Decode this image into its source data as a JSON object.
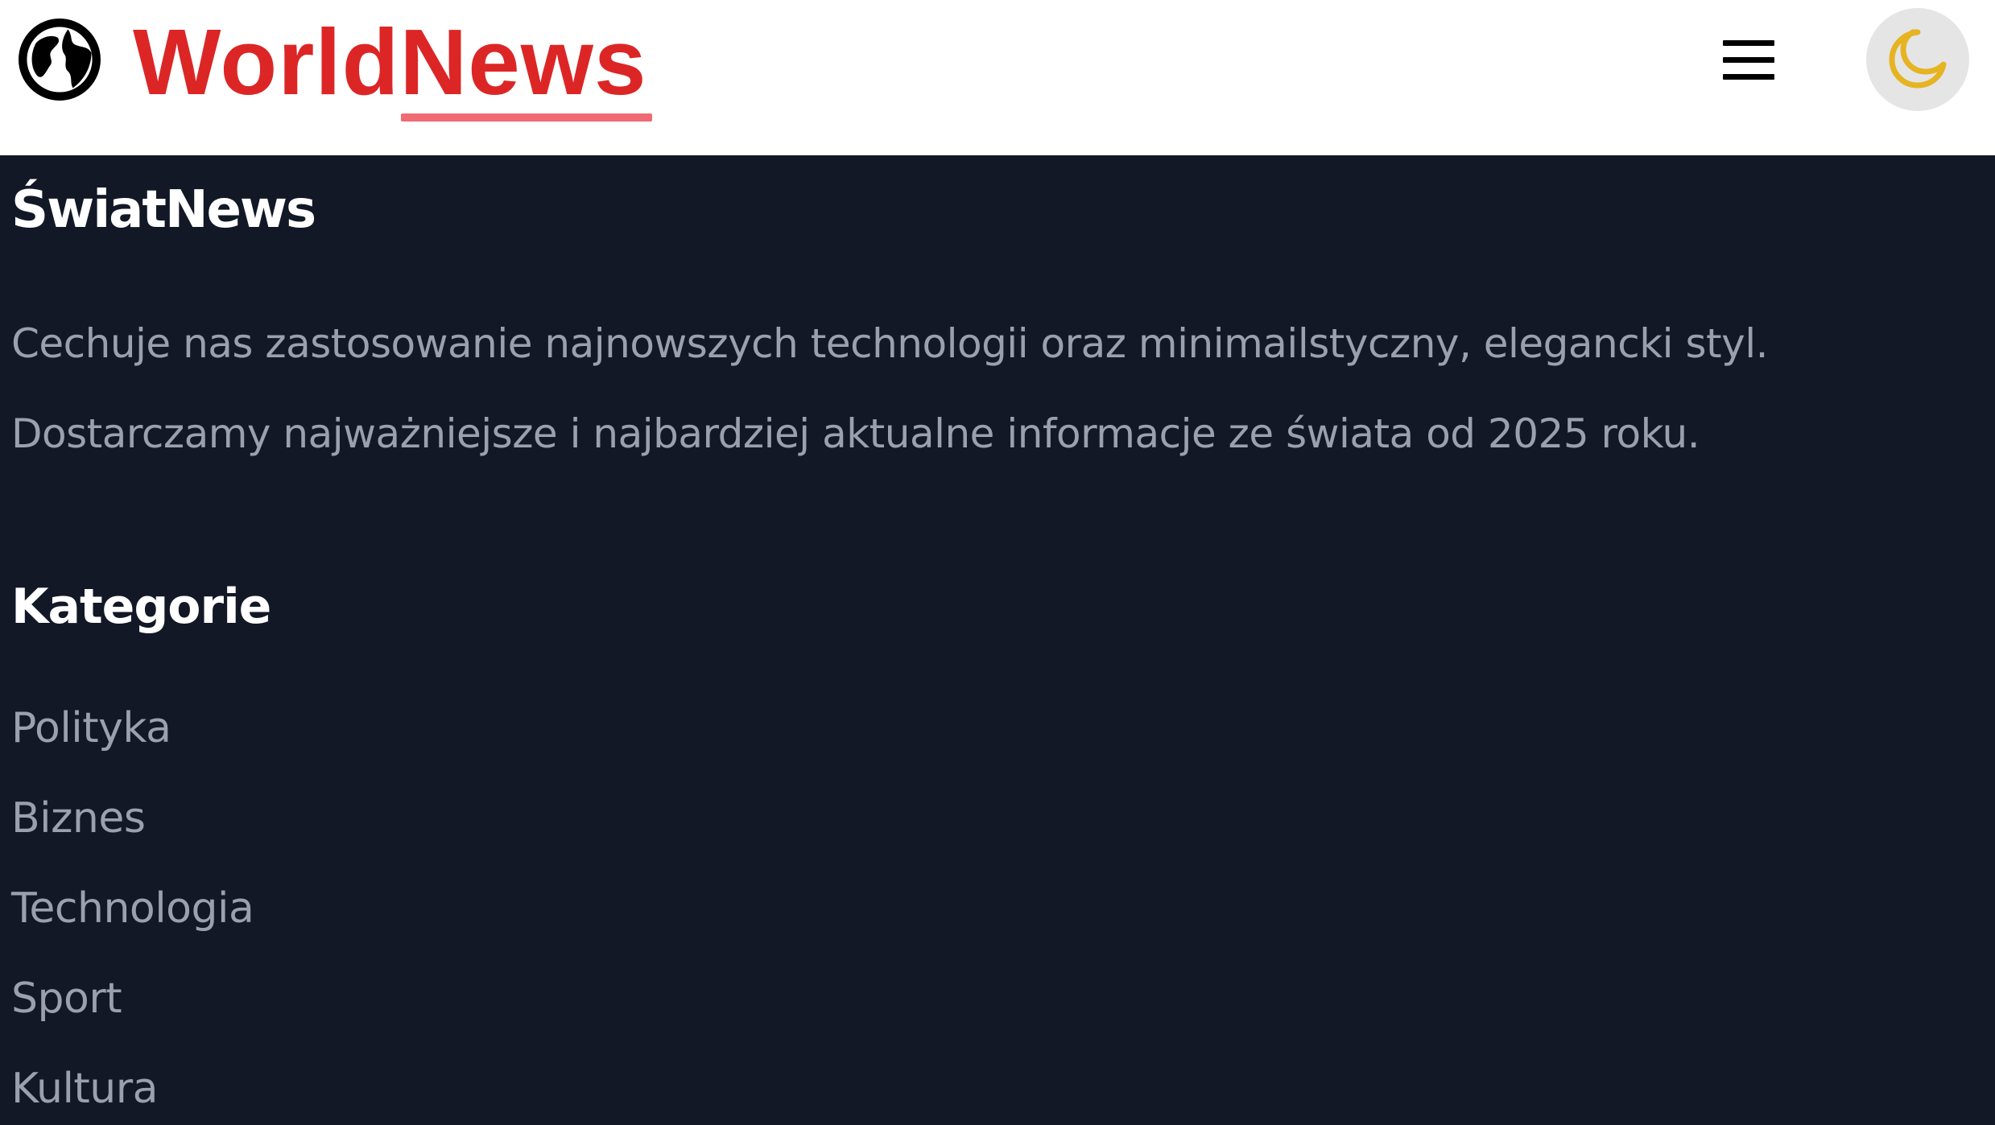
{
  "header": {
    "brand_part1": "World",
    "brand_part2": "News",
    "brand_color": "#dc2626",
    "underline_color": "#f06a74",
    "logo_icon": "globe-icon",
    "menu_icon": "hamburger-menu-icon",
    "theme_icon": "moon-icon",
    "theme_icon_color": "#e6b422"
  },
  "footer": {
    "title": "ŚwiatNews",
    "description": [
      "Cechuje nas zastosowanie najnowszych technologii oraz minimailstyczny, elegancki styl.",
      "Dostarczamy najważniejsze i najbardziej aktualne informacje ze świata od 2025 roku."
    ],
    "categories_title": "Kategorie",
    "categories": [
      "Polityka",
      "Biznes",
      "Technologia",
      "Sport",
      "Kultura"
    ],
    "background": "#131827"
  }
}
